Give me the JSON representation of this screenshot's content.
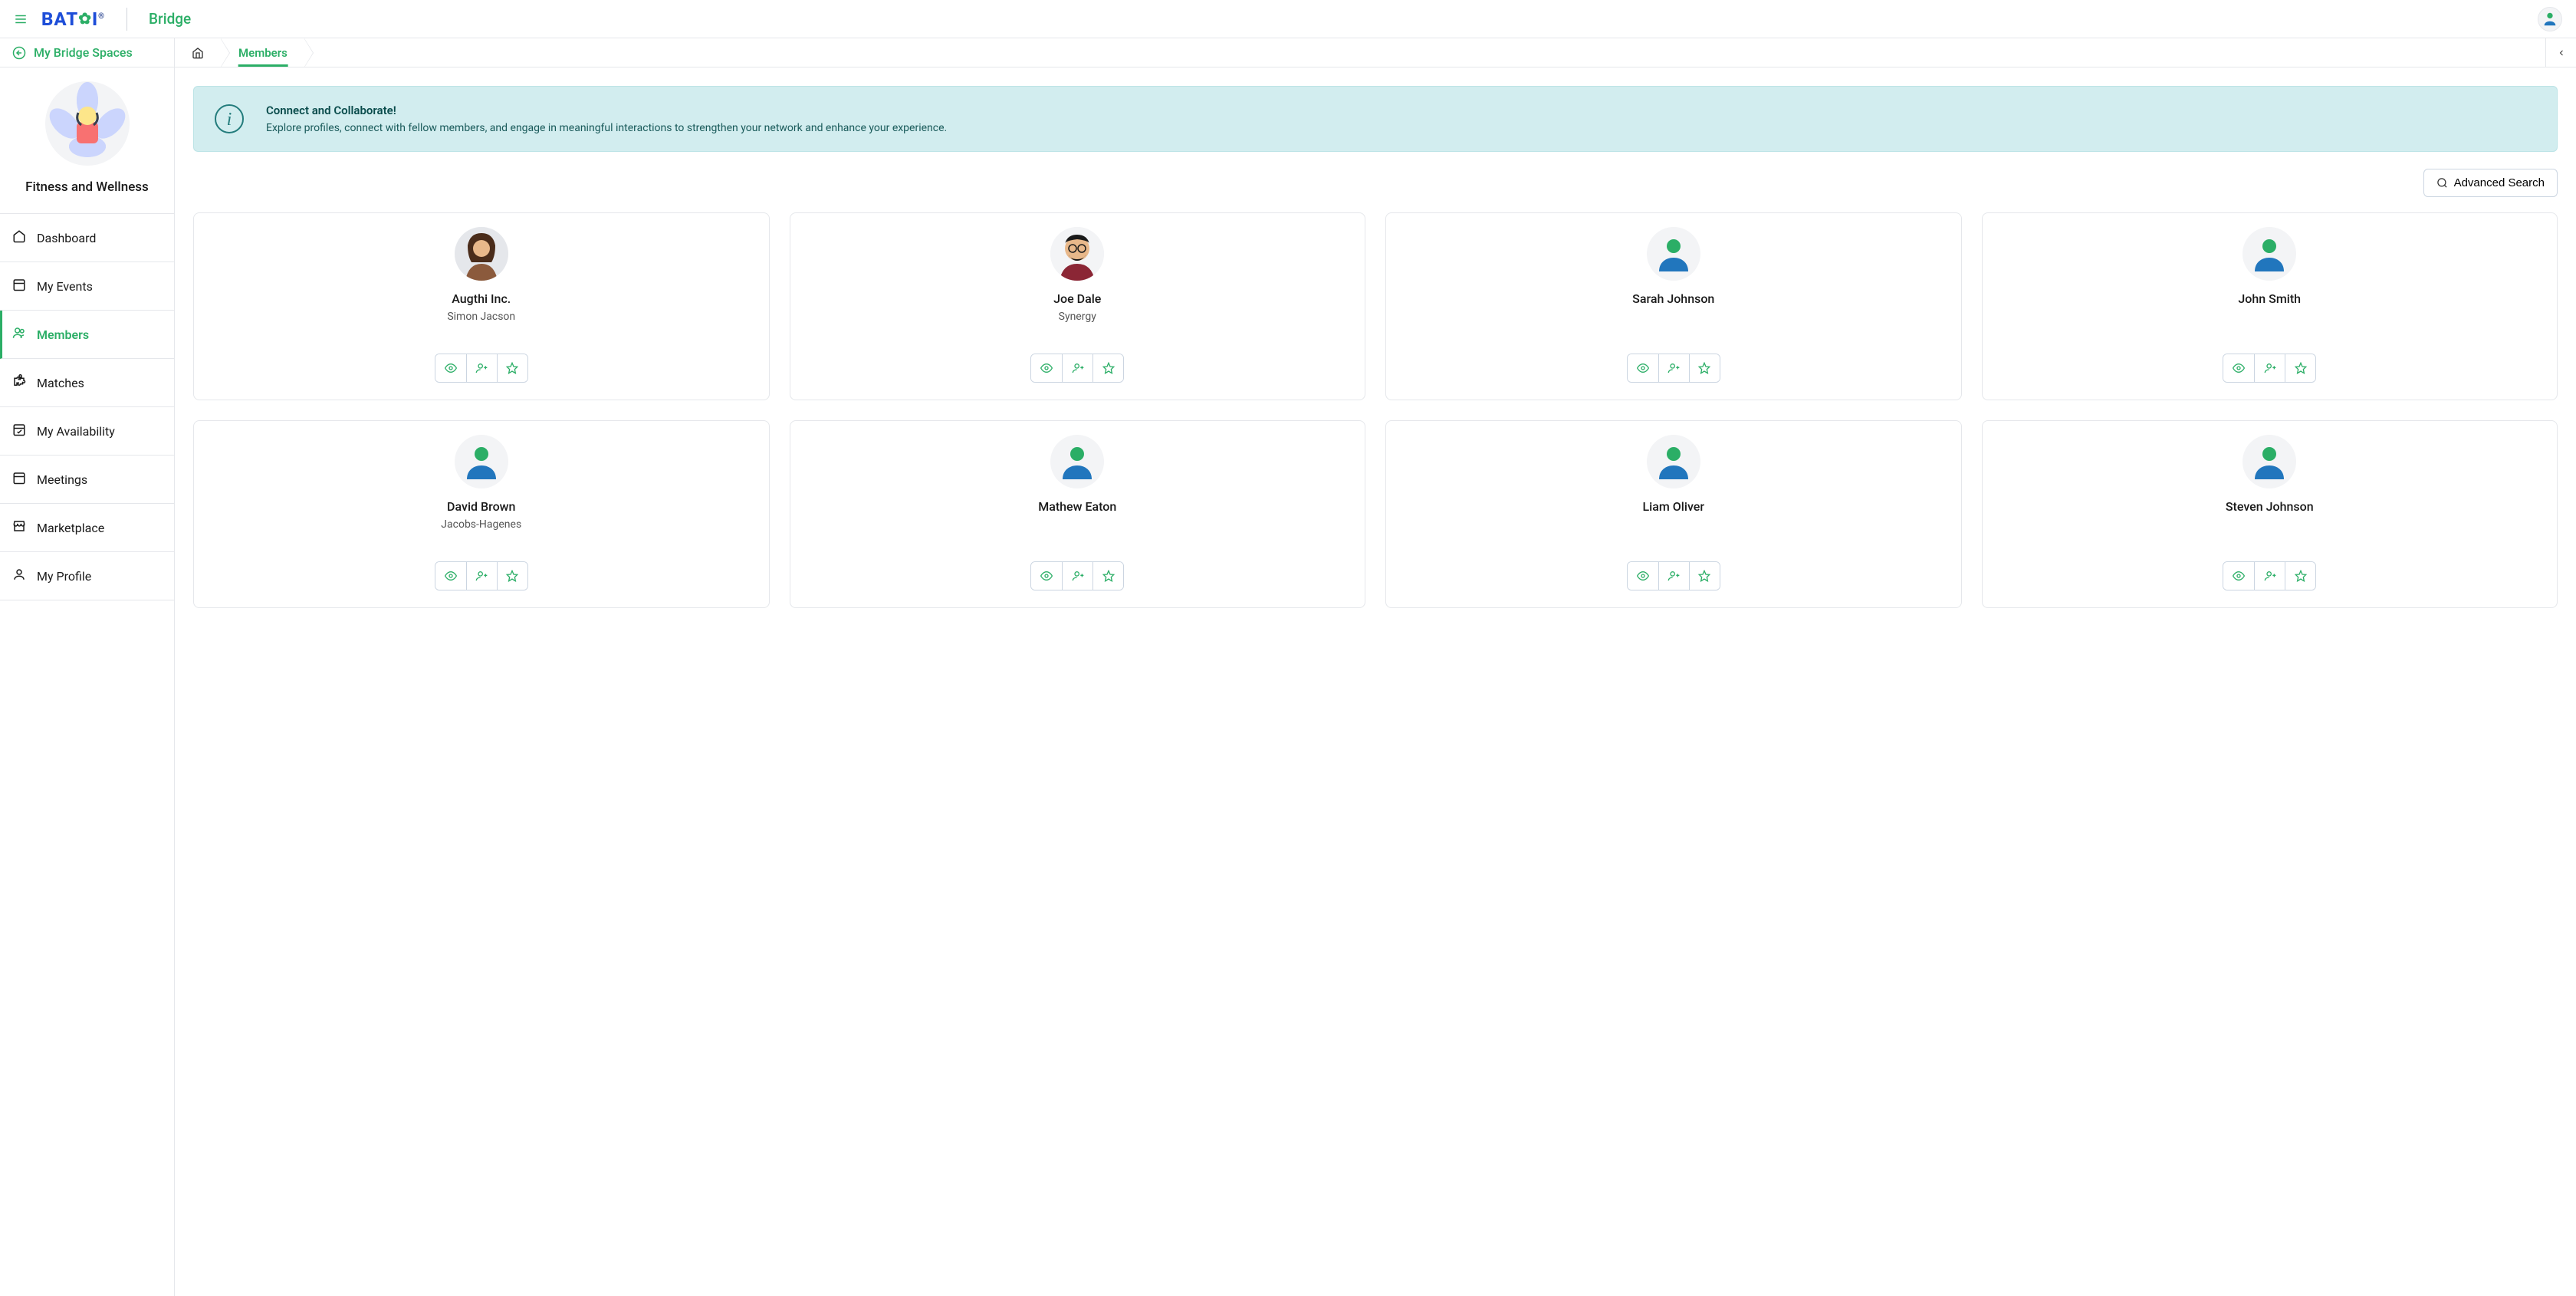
{
  "brand": {
    "name": "BAT",
    "leaf": "🍃",
    "rest": "I",
    "reg": "®"
  },
  "app_name": "Bridge",
  "user_menu": {
    "tooltip": "Account"
  },
  "back_link": "My Bridge Spaces",
  "breadcrumb": {
    "active": "Members"
  },
  "space": {
    "title": "Fitness and Wellness"
  },
  "nav": [
    {
      "label": "Dashboard",
      "icon": "home"
    },
    {
      "label": "My Events",
      "icon": "calendar"
    },
    {
      "label": "Members",
      "icon": "users",
      "active": true
    },
    {
      "label": "Matches",
      "icon": "puzzle"
    },
    {
      "label": "My Availability",
      "icon": "calendar-check"
    },
    {
      "label": "Meetings",
      "icon": "calendar"
    },
    {
      "label": "Marketplace",
      "icon": "store"
    },
    {
      "label": "My Profile",
      "icon": "user"
    }
  ],
  "banner": {
    "title": "Connect and Collaborate!",
    "text": "Explore profiles, connect with fellow members, and engage in meaningful interactions to strengthen your network and enhance your experience."
  },
  "advanced_search": "Advanced Search",
  "members": [
    {
      "name": "Augthi Inc.",
      "sub": "Simon Jacson",
      "avatar": "photo1"
    },
    {
      "name": "Joe Dale",
      "sub": "Synergy",
      "avatar": "photo2"
    },
    {
      "name": "Sarah Johnson",
      "sub": "",
      "avatar": "default"
    },
    {
      "name": "John Smith",
      "sub": "",
      "avatar": "default"
    },
    {
      "name": "David Brown",
      "sub": "Jacobs-Hagenes",
      "avatar": "default"
    },
    {
      "name": "Mathew Eaton",
      "sub": "",
      "avatar": "default"
    },
    {
      "name": "Liam Oliver",
      "sub": "",
      "avatar": "default"
    },
    {
      "name": "Steven Johnson",
      "sub": "",
      "avatar": "default"
    }
  ],
  "colors": {
    "accent": "#2BAE66",
    "brand": "#1e3a8a"
  }
}
